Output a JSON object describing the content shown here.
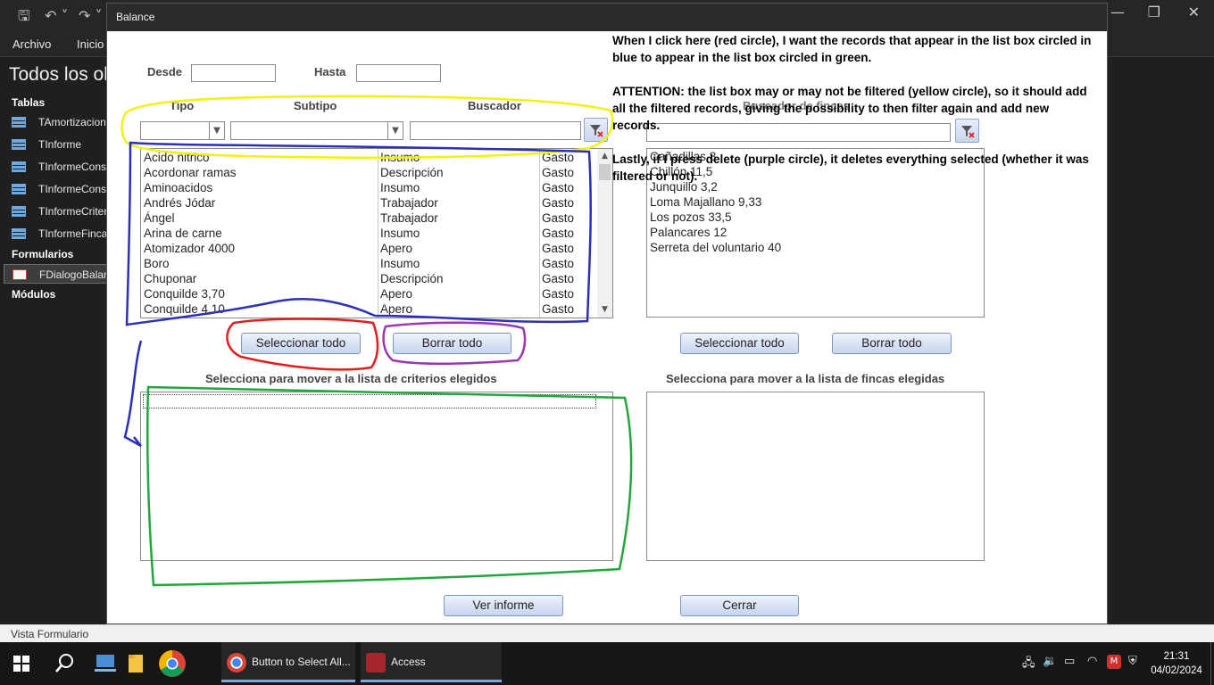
{
  "access": {
    "ribbon_tabs": [
      "Archivo",
      "Inicio"
    ],
    "nav_title": "Todos los ol",
    "nav_groups": {
      "tablas": "Tablas",
      "formularios": "Formularios",
      "modulos": "Módulos"
    },
    "tables": [
      "TAmortizacion",
      "TInforme",
      "TInformeCons",
      "TInformeCons",
      "TInformeCriter",
      "TInformeFinca"
    ],
    "forms": [
      "FDialogoBalan"
    ],
    "status_text": "Vista Formulario"
  },
  "dialog": {
    "title": "Balance",
    "desde_label": "Desde",
    "hasta_label": "Hasta",
    "desde_value": "",
    "hasta_value": "",
    "tipo_label": "Tipo",
    "subtipo_label": "Subtipo",
    "buscador_label": "Buscador",
    "fincas_search_label": "Buscador de fincas",
    "criteria_list": [
      [
        "Acido nitrico",
        "Insumo",
        "Gasto"
      ],
      [
        "Acordonar ramas",
        "Descripción",
        "Gasto"
      ],
      [
        "Aminoacidos",
        "Insumo",
        "Gasto"
      ],
      [
        "Andrés Jódar",
        "Trabajador",
        "Gasto"
      ],
      [
        "Ángel",
        "Trabajador",
        "Gasto"
      ],
      [
        "Arina de carne",
        "Insumo",
        "Gasto"
      ],
      [
        "Atomizador 4000",
        "Apero",
        "Gasto"
      ],
      [
        "Boro",
        "Insumo",
        "Gasto"
      ],
      [
        "Chuponar",
        "Descripción",
        "Gasto"
      ],
      [
        "Conquilde 3,70",
        "Apero",
        "Gasto"
      ],
      [
        "Conquilde 4,10",
        "Apero",
        "Gasto"
      ]
    ],
    "fincas_list": [
      "Cañadillas 8",
      "Chillón 11,5",
      "Junquillo  3,2",
      "Loma Majallano  9,33",
      "Los pozos  33,5",
      "Palancares 12",
      "Serreta del voluntario  40"
    ],
    "btn_select_all": "Seleccionar todo",
    "btn_clear_all": "Borrar todo",
    "btn_select_all_fincas": "Seleccionar todo",
    "btn_clear_all_fincas": "Borrar todo",
    "criteria_chosen_label": "Selecciona para mover a la lista de criterios elegidos",
    "fincas_chosen_label": "Selecciona para mover a la lista de fincas  elegidas",
    "btn_ver_informe": "Ver informe",
    "btn_cerrar": "Cerrar"
  },
  "annotation": {
    "paragraphs": [
      "When I click here (red circle), I want the records that appear in the list box circled in blue to appear in the list box circled in green.",
      "ATTENTION: the list box may or may not be filtered (yellow circle), so it should add all the filtered records, giving the possibility to then filter again and add new records.",
      "Lastly, if I press delete (purple circle), it deletes everything selected (whether it was filtered or not)."
    ],
    "colors": {
      "red": "#e11d1d",
      "blue": "#2c2fb8",
      "green": "#22a83a",
      "yellow": "#f2f20a",
      "purple": "#9b36b4"
    }
  },
  "taskbar": {
    "apps": [
      "Button to Select All...",
      "Access"
    ],
    "time": "21:31",
    "date": "04/02/2024"
  }
}
